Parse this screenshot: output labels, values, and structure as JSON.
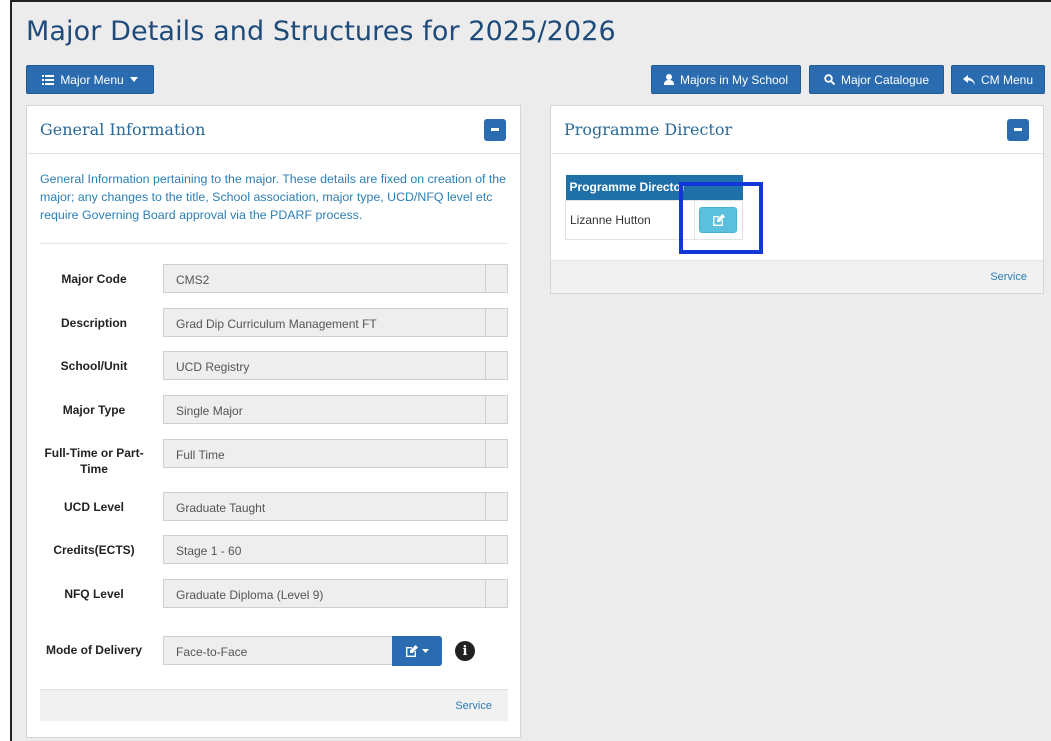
{
  "page": {
    "title": "Major Details and Structures for 2025/2026"
  },
  "toolbar": {
    "major_menu": "Major Menu",
    "majors_in_school": "Majors in My School",
    "major_catalogue": "Major Catalogue",
    "cm_menu": "CM Menu"
  },
  "general": {
    "title": "General Information",
    "intro": "General Information pertaining to the major. These details are fixed on creation of the major; any changes to the title, School association, major type, UCD/NFQ level etc require Governing Board approval via the PDARF process.",
    "fields": [
      {
        "label": "Major Code",
        "value": "CMS2"
      },
      {
        "label": "Description",
        "value": "Grad Dip Curriculum Management FT"
      },
      {
        "label": "School/Unit",
        "value": "UCD Registry"
      },
      {
        "label": "Major Type",
        "value": "Single Major"
      },
      {
        "label": "Full-Time or Part-Time",
        "value": "Full Time"
      },
      {
        "label": "UCD Level",
        "value": "Graduate Taught"
      },
      {
        "label": "Credits(ECTS)",
        "value": "Stage 1 - 60"
      },
      {
        "label": "NFQ Level",
        "value": "Graduate Diploma (Level 9)"
      }
    ],
    "mode_label": "Mode of Delivery",
    "mode_value": "Face-to-Face",
    "service": "Service"
  },
  "director": {
    "title": "Programme Director",
    "column": "Programme Director",
    "name": "Lizanne Hutton",
    "service": "Service"
  },
  "colors": {
    "primary": "#2b6cb0",
    "info": "#5bc0de",
    "highlight": "#1336d6",
    "title": "#1f4b7a"
  },
  "icons": {
    "major_menu": "list-icon",
    "majors_in_school": "user-icon",
    "major_catalogue": "search-icon",
    "cm_menu": "reply-icon",
    "edit": "edit-icon",
    "info": "info-circle-icon"
  }
}
